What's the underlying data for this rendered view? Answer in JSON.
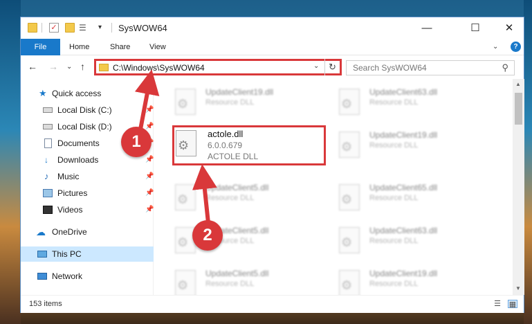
{
  "window": {
    "title": "SysWOW64",
    "minimize_glyph": "—",
    "maximize_glyph": "☐",
    "close_glyph": "✕"
  },
  "ribbon": {
    "tabs": [
      "File",
      "Home",
      "Share",
      "View"
    ],
    "expand_glyph": "⌄",
    "help_glyph": "?"
  },
  "navigation": {
    "back_glyph": "←",
    "forward_glyph": "→",
    "recent_glyph": "⌄",
    "up_glyph": "↑",
    "address": "C:\\Windows\\SysWOW64",
    "address_dropdown_glyph": "⌄",
    "refresh_glyph": "↻",
    "search_placeholder": "Search SysWOW64",
    "search_glyph": "⚲"
  },
  "sidebar": {
    "items": [
      {
        "label": "Quick access",
        "icon": "star-icon",
        "pinned": false
      },
      {
        "label": "Local Disk (C:)",
        "icon": "drive-icon",
        "pinned": true
      },
      {
        "label": "Local Disk (D:)",
        "icon": "drive-icon",
        "pinned": true
      },
      {
        "label": "Documents",
        "icon": "document-icon",
        "pinned": true
      },
      {
        "label": "Downloads",
        "icon": "download-icon",
        "pinned": true
      },
      {
        "label": "Music",
        "icon": "music-icon",
        "pinned": true
      },
      {
        "label": "Pictures",
        "icon": "pictures-icon",
        "pinned": true
      },
      {
        "label": "Videos",
        "icon": "videos-icon",
        "pinned": true
      },
      {
        "label": "OneDrive",
        "icon": "cloud-icon",
        "pinned": false
      },
      {
        "label": "This PC",
        "icon": "computer-icon",
        "pinned": false,
        "selected": true
      },
      {
        "label": "Network",
        "icon": "network-icon",
        "pinned": false
      }
    ],
    "pin_glyph": "📌",
    "star_glyph": "★",
    "download_glyph": "↓",
    "music_glyph": "♪",
    "cloud_glyph": "☁"
  },
  "files": [
    {
      "name": "UpdateClient19.dll",
      "line2": "Resource DLL",
      "line3": "",
      "blurred": true
    },
    {
      "name": "UpdateClient63.dll",
      "line2": "Resource DLL",
      "line3": "",
      "blurred": true
    },
    {
      "name": "actole.dll",
      "line2": "6.0.0.679",
      "line3": "ACTOLE DLL",
      "blurred": false,
      "highlighted": true
    },
    {
      "name": "UpdateClient19.dll",
      "line2": "Resource DLL",
      "line3": "",
      "blurred": true
    },
    {
      "name": "UpdateClient5.dll",
      "line2": "Resource DLL",
      "line3": "",
      "blurred": true
    },
    {
      "name": "UpdateClient65.dll",
      "line2": "Resource DLL",
      "line3": "",
      "blurred": true
    },
    {
      "name": "UpdateClient5.dll",
      "line2": "Resource DLL",
      "line3": "",
      "blurred": true
    },
    {
      "name": "UpdateClient63.dll",
      "line2": "Resource DLL",
      "line3": "",
      "blurred": true
    },
    {
      "name": "UpdateClient5.dll",
      "line2": "Resource DLL",
      "line3": "",
      "blurred": true
    },
    {
      "name": "UpdateClient19.dll",
      "line2": "Resource DLL",
      "line3": "",
      "blurred": true
    }
  ],
  "scrollbar": {
    "up_glyph": "▲",
    "down_glyph": "▼"
  },
  "status": {
    "item_count": "153 items",
    "details_view_glyph": "☰",
    "tiles_view_glyph": "▦"
  },
  "annotations": [
    {
      "number": "1",
      "color": "#d9383a"
    },
    {
      "number": "2",
      "color": "#d9383a"
    }
  ]
}
